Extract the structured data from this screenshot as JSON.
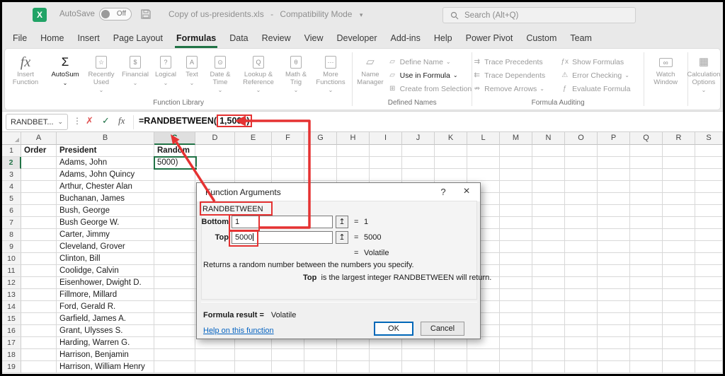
{
  "window": {
    "autosave_label": "AutoSave",
    "autosave_state": "Off",
    "title": "Copy of us-presidents.xls",
    "title_separator": "-",
    "title_mode": "Compatibility Mode",
    "search_placeholder": "Search (Alt+Q)"
  },
  "ribbon": {
    "tabs": [
      "File",
      "Home",
      "Insert",
      "Page Layout",
      "Formulas",
      "Data",
      "Review",
      "View",
      "Developer",
      "Add-ins",
      "Help",
      "Power Pivot",
      "Custom",
      "Team"
    ],
    "active_tab": "Formulas",
    "groups": {
      "function_library": {
        "label": "Function Library",
        "insert_function": "Insert Function",
        "autosum": "AutoSum",
        "buttons": [
          {
            "label": "Recently Used",
            "icon": "recently-used"
          },
          {
            "label": "Financial",
            "icon": "financial"
          },
          {
            "label": "Logical",
            "icon": "logical"
          },
          {
            "label": "Text",
            "icon": "text"
          },
          {
            "label": "Date & Time",
            "icon": "date-time"
          },
          {
            "label": "Lookup & Reference",
            "icon": "lookup-reference"
          },
          {
            "label": "Math & Trig",
            "icon": "math-trig"
          },
          {
            "label": "More Functions",
            "icon": "more-functions"
          }
        ]
      },
      "defined_names": {
        "label": "Defined Names",
        "name_manager": "Name Manager",
        "items": [
          {
            "label": "Define Name",
            "icon": "define-name",
            "dropdown": true,
            "dark": false
          },
          {
            "label": "Use in Formula",
            "icon": "use-in-formula",
            "dropdown": true,
            "dark": true
          },
          {
            "label": "Create from Selection",
            "icon": "create-from-selection",
            "dropdown": false,
            "dark": false
          }
        ]
      },
      "formula_auditing": {
        "label": "Formula Auditing",
        "left_items": [
          {
            "label": "Trace Precedents",
            "icon": "trace-precedents",
            "dropdown": false
          },
          {
            "label": "Trace Dependents",
            "icon": "trace-dependents",
            "dropdown": false
          },
          {
            "label": "Remove Arrows",
            "icon": "remove-arrows",
            "dropdown": true
          }
        ],
        "right_items": [
          {
            "label": "Show Formulas",
            "icon": "show-formulas",
            "dropdown": false
          },
          {
            "label": "Error Checking",
            "icon": "error-checking",
            "dropdown": true
          },
          {
            "label": "Evaluate Formula",
            "icon": "evaluate-formula",
            "dropdown": false
          }
        ]
      },
      "watch_window": "Watch Window",
      "calculation_options": "Calculation Options"
    }
  },
  "formula_bar": {
    "name_box": "RANDBET...",
    "formula_prefix": "=RANDBETWEEN(",
    "formula_boxed": "1,5000)"
  },
  "sheet": {
    "columns": [
      "A",
      "B",
      "C",
      "D",
      "E",
      "F",
      "G",
      "H",
      "I",
      "J",
      "K",
      "L",
      "M",
      "N",
      "O",
      "P",
      "Q",
      "R",
      "S"
    ],
    "selected_column": "C",
    "selected_row": 2,
    "active_cell": "C2",
    "active_cell_value": "5000)",
    "rows": [
      {
        "n": 1,
        "a": "Order",
        "b": "President",
        "c": "Random"
      },
      {
        "n": 2,
        "a": "",
        "b": "Adams, John",
        "c": "5000)"
      },
      {
        "n": 3,
        "a": "",
        "b": "Adams, John Quincy",
        "c": ""
      },
      {
        "n": 4,
        "a": "",
        "b": "Arthur, Chester Alan",
        "c": ""
      },
      {
        "n": 5,
        "a": "",
        "b": "Buchanan, James",
        "c": ""
      },
      {
        "n": 6,
        "a": "",
        "b": "Bush, George",
        "c": ""
      },
      {
        "n": 7,
        "a": "",
        "b": "Bush George W.",
        "c": ""
      },
      {
        "n": 8,
        "a": "",
        "b": "Carter, Jimmy",
        "c": ""
      },
      {
        "n": 9,
        "a": "",
        "b": "Cleveland, Grover",
        "c": ""
      },
      {
        "n": 10,
        "a": "",
        "b": "Clinton, Bill",
        "c": ""
      },
      {
        "n": 11,
        "a": "",
        "b": "Coolidge, Calvin",
        "c": ""
      },
      {
        "n": 12,
        "a": "",
        "b": "Eisenhower, Dwight D.",
        "c": ""
      },
      {
        "n": 13,
        "a": "",
        "b": "Fillmore, Millard",
        "c": ""
      },
      {
        "n": 14,
        "a": "",
        "b": "Ford, Gerald R.",
        "c": ""
      },
      {
        "n": 15,
        "a": "",
        "b": "Garfield, James A.",
        "c": ""
      },
      {
        "n": 16,
        "a": "",
        "b": "Grant, Ulysses S.",
        "c": ""
      },
      {
        "n": 17,
        "a": "",
        "b": "Harding, Warren G.",
        "c": ""
      },
      {
        "n": 18,
        "a": "",
        "b": "Harrison, Benjamin",
        "c": ""
      },
      {
        "n": 19,
        "a": "",
        "b": "Harrison, William Henry",
        "c": ""
      }
    ]
  },
  "dialog": {
    "title": "Function Arguments",
    "help_glyph": "?",
    "close_glyph": "×",
    "function_name": "RANDBETWEEN",
    "equals": "=",
    "args": [
      {
        "label": "Bottom",
        "value": "1",
        "result": "1",
        "cursor": false
      },
      {
        "label": "Top",
        "value": "5000",
        "result": "5000",
        "cursor": true
      }
    ],
    "volatile_result": "Volatile",
    "description": "Returns a random number between the numbers you specify.",
    "arg_help_bold": "Top",
    "arg_help_rest": "is the largest integer RANDBETWEEN will return.",
    "formula_result_label": "Formula result =",
    "formula_result_value": "Volatile",
    "help_link": "Help on this function",
    "ok_label": "OK",
    "cancel_label": "Cancel"
  },
  "colors": {
    "annotation_red": "#e53232",
    "excel_green": "#217346",
    "link_blue": "#0563c1",
    "ok_border_blue": "#0067b8"
  }
}
